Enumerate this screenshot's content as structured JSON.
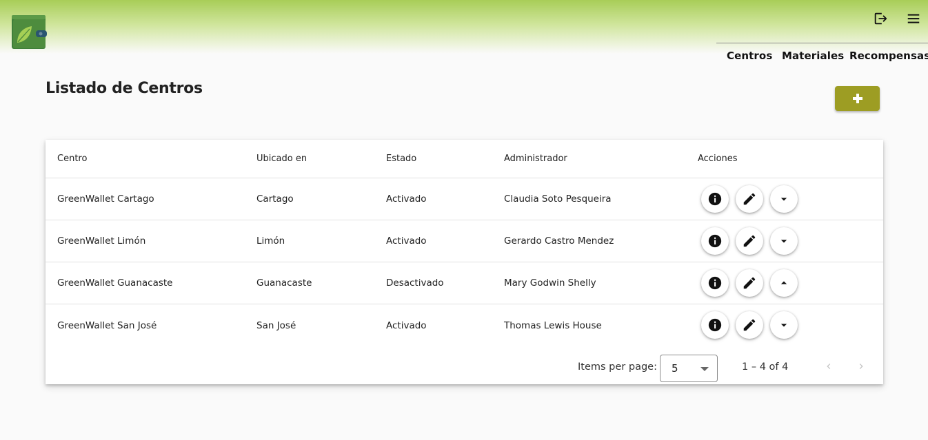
{
  "header": {
    "logo_icon": "wallet-leaf-logo",
    "logout_icon": "logout-icon",
    "menu_icon": "hamburger-menu-icon",
    "nav": [
      "Centros",
      "Materiales",
      "Recompensas"
    ],
    "gradient_color": "#a8cd58"
  },
  "page": {
    "title": "Listado de Centros",
    "add_button_icon": "plus-icon",
    "add_button_color": "#9d9d23"
  },
  "table": {
    "columns": [
      "Centro",
      "Ubicado en",
      "Estado",
      "Administrador",
      "Acciones"
    ],
    "rows": [
      {
        "centro": "GreenWallet Cartago",
        "ubicado": "Cartago",
        "estado": "Activado",
        "admin": "Claudia Soto Pesqueira",
        "toggle": "arrow-down"
      },
      {
        "centro": "GreenWallet Limón",
        "ubicado": "Limón",
        "estado": "Activado",
        "admin": "Gerardo Castro Mendez",
        "toggle": "arrow-down"
      },
      {
        "centro": "GreenWallet Guanacaste",
        "ubicado": "Guanacaste",
        "estado": "Desactivado",
        "admin": "Mary Godwin Shelly",
        "toggle": "arrow-up"
      },
      {
        "centro": "GreenWallet San José",
        "ubicado": "San José",
        "estado": "Activado",
        "admin": "Thomas Lewis House",
        "toggle": "arrow-down"
      }
    ],
    "action_icons": [
      "info-icon",
      "edit-icon",
      "toggle-status-icon"
    ]
  },
  "paginator": {
    "items_label": "Items per page:",
    "page_size": "5",
    "range": "1 – 4 of 4"
  }
}
